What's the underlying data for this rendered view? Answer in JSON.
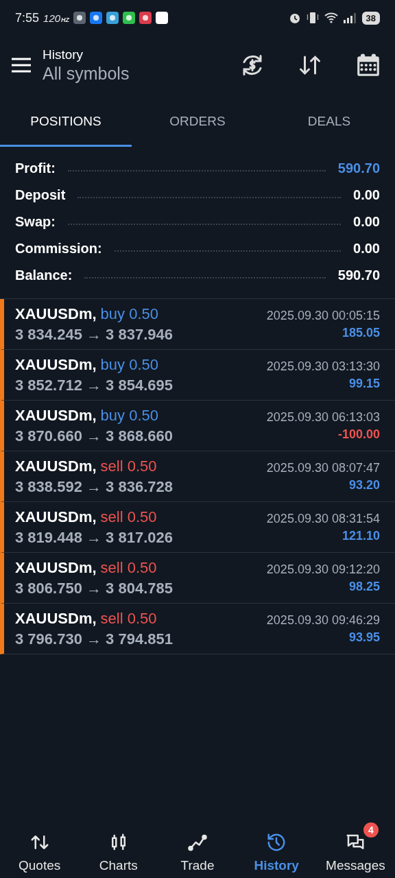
{
  "status_bar": {
    "time": "7:55",
    "refresh": "120",
    "refresh_unit": "HZ",
    "battery": "38"
  },
  "header": {
    "title": "History",
    "subtitle": "All symbols"
  },
  "tabs": [
    {
      "label": "POSITIONS",
      "selected": true
    },
    {
      "label": "ORDERS",
      "selected": false
    },
    {
      "label": "DEALS",
      "selected": false
    }
  ],
  "summary": [
    {
      "label": "Profit:",
      "value": "590.70",
      "highlight": true
    },
    {
      "label": "Deposit",
      "value": "0.00",
      "highlight": false
    },
    {
      "label": "Swap:",
      "value": "0.00",
      "highlight": false
    },
    {
      "label": "Commission:",
      "value": "0.00",
      "highlight": false
    },
    {
      "label": "Balance:",
      "value": "590.70",
      "highlight": false
    }
  ],
  "positions": [
    {
      "symbol": "XAUUSDm,",
      "kind": "buy",
      "trade": "buy 0.50",
      "prices": "3 834.245 → 3 837.946",
      "time": "2025.09.30 00:05:15",
      "profit": "185.05",
      "loss": false
    },
    {
      "symbol": "XAUUSDm,",
      "kind": "buy",
      "trade": "buy 0.50",
      "prices": "3 852.712 → 3 854.695",
      "time": "2025.09.30 03:13:30",
      "profit": "99.15",
      "loss": false
    },
    {
      "symbol": "XAUUSDm,",
      "kind": "buy",
      "trade": "buy 0.50",
      "prices": "3 870.660 → 3 868.660",
      "time": "2025.09.30 06:13:03",
      "profit": "-100.00",
      "loss": true
    },
    {
      "symbol": "XAUUSDm,",
      "kind": "sell",
      "trade": "sell 0.50",
      "prices": "3 838.592 → 3 836.728",
      "time": "2025.09.30 08:07:47",
      "profit": "93.20",
      "loss": false
    },
    {
      "symbol": "XAUUSDm,",
      "kind": "sell",
      "trade": "sell 0.50",
      "prices": "3 819.448 → 3 817.026",
      "time": "2025.09.30 08:31:54",
      "profit": "121.10",
      "loss": false
    },
    {
      "symbol": "XAUUSDm,",
      "kind": "sell",
      "trade": "sell 0.50",
      "prices": "3 806.750 → 3 804.785",
      "time": "2025.09.30 09:12:20",
      "profit": "98.25",
      "loss": false
    },
    {
      "symbol": "XAUUSDm,",
      "kind": "sell",
      "trade": "sell 0.50",
      "prices": "3 796.730 → 3 794.851",
      "time": "2025.09.30 09:46:29",
      "profit": "93.95",
      "loss": false
    }
  ],
  "bottom_nav": [
    {
      "label": "Quotes",
      "kind": "quotes",
      "selected": false
    },
    {
      "label": "Charts",
      "kind": "charts",
      "selected": false
    },
    {
      "label": "Trade",
      "kind": "trade",
      "selected": false
    },
    {
      "label": "History",
      "kind": "history",
      "selected": true
    },
    {
      "label": "Messages",
      "kind": "messages",
      "selected": false,
      "badge": "4"
    }
  ]
}
